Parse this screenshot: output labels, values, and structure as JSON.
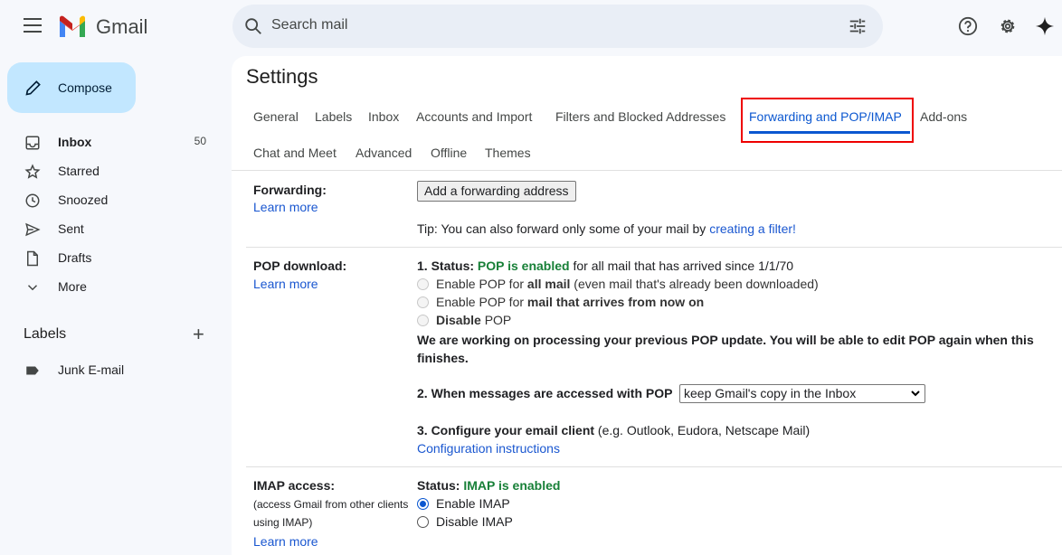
{
  "app": {
    "name": "Gmail"
  },
  "search": {
    "placeholder": "Search mail"
  },
  "sidebar": {
    "compose": "Compose",
    "items": [
      {
        "label": "Inbox",
        "count": "50",
        "icon": "inbox-icon"
      },
      {
        "label": "Starred",
        "icon": "star-icon"
      },
      {
        "label": "Snoozed",
        "icon": "clock-icon"
      },
      {
        "label": "Sent",
        "icon": "send-icon"
      },
      {
        "label": "Drafts",
        "icon": "draft-icon"
      },
      {
        "label": "More",
        "icon": "chevron-down-icon"
      }
    ],
    "labels_heading": "Labels",
    "labels": [
      {
        "label": "Junk E-mail"
      }
    ]
  },
  "settings": {
    "title": "Settings",
    "tabs": [
      "General",
      "Labels",
      "Inbox",
      "Accounts and Import",
      "Filters and Blocked Addresses",
      "Forwarding and POP/IMAP",
      "Add-ons",
      "Chat and Meet",
      "Advanced",
      "Offline",
      "Themes"
    ],
    "active_tab": "Forwarding and POP/IMAP",
    "forwarding": {
      "label": "Forwarding:",
      "learn_more": "Learn more",
      "button": "Add a forwarding address",
      "tip": "Tip: You can also forward only some of your mail by ",
      "tip_link": "creating a filter!"
    },
    "pop": {
      "label": "POP download:",
      "learn_more": "Learn more",
      "status_prefix": "1. Status: ",
      "status": "POP is enabled",
      "status_suffix": " for all mail that has arrived since 1/1/70",
      "opt1_a": "Enable POP for ",
      "opt1_b": "all mail",
      "opt1_c": " (even mail that's already been downloaded)",
      "opt2_a": "Enable POP for ",
      "opt2_b": "mail that arrives from now on",
      "opt3_a": "Disable",
      "opt3_b": " POP",
      "notice": "We are working on processing your previous POP update. You will be able to edit POP again when this finishes.",
      "when_label": "2. When messages are accessed with POP",
      "when_value": "keep Gmail's copy in the Inbox",
      "configure_label": "3. Configure your email client",
      "configure_hint": " (e.g. Outlook, Eudora, Netscape Mail)",
      "config_link": "Configuration instructions"
    },
    "imap": {
      "label": "IMAP access:",
      "sub1": "(access Gmail from other clients",
      "sub2": "using IMAP)",
      "learn_more": "Learn more",
      "status_prefix": "Status: ",
      "status": "IMAP is enabled",
      "enable": "Enable IMAP",
      "disable": "Disable IMAP",
      "selected": "Enable IMAP"
    }
  },
  "colors": {
    "accent": "#0b57d0",
    "status_green": "#188038",
    "highlight_box": "#ee0000"
  }
}
